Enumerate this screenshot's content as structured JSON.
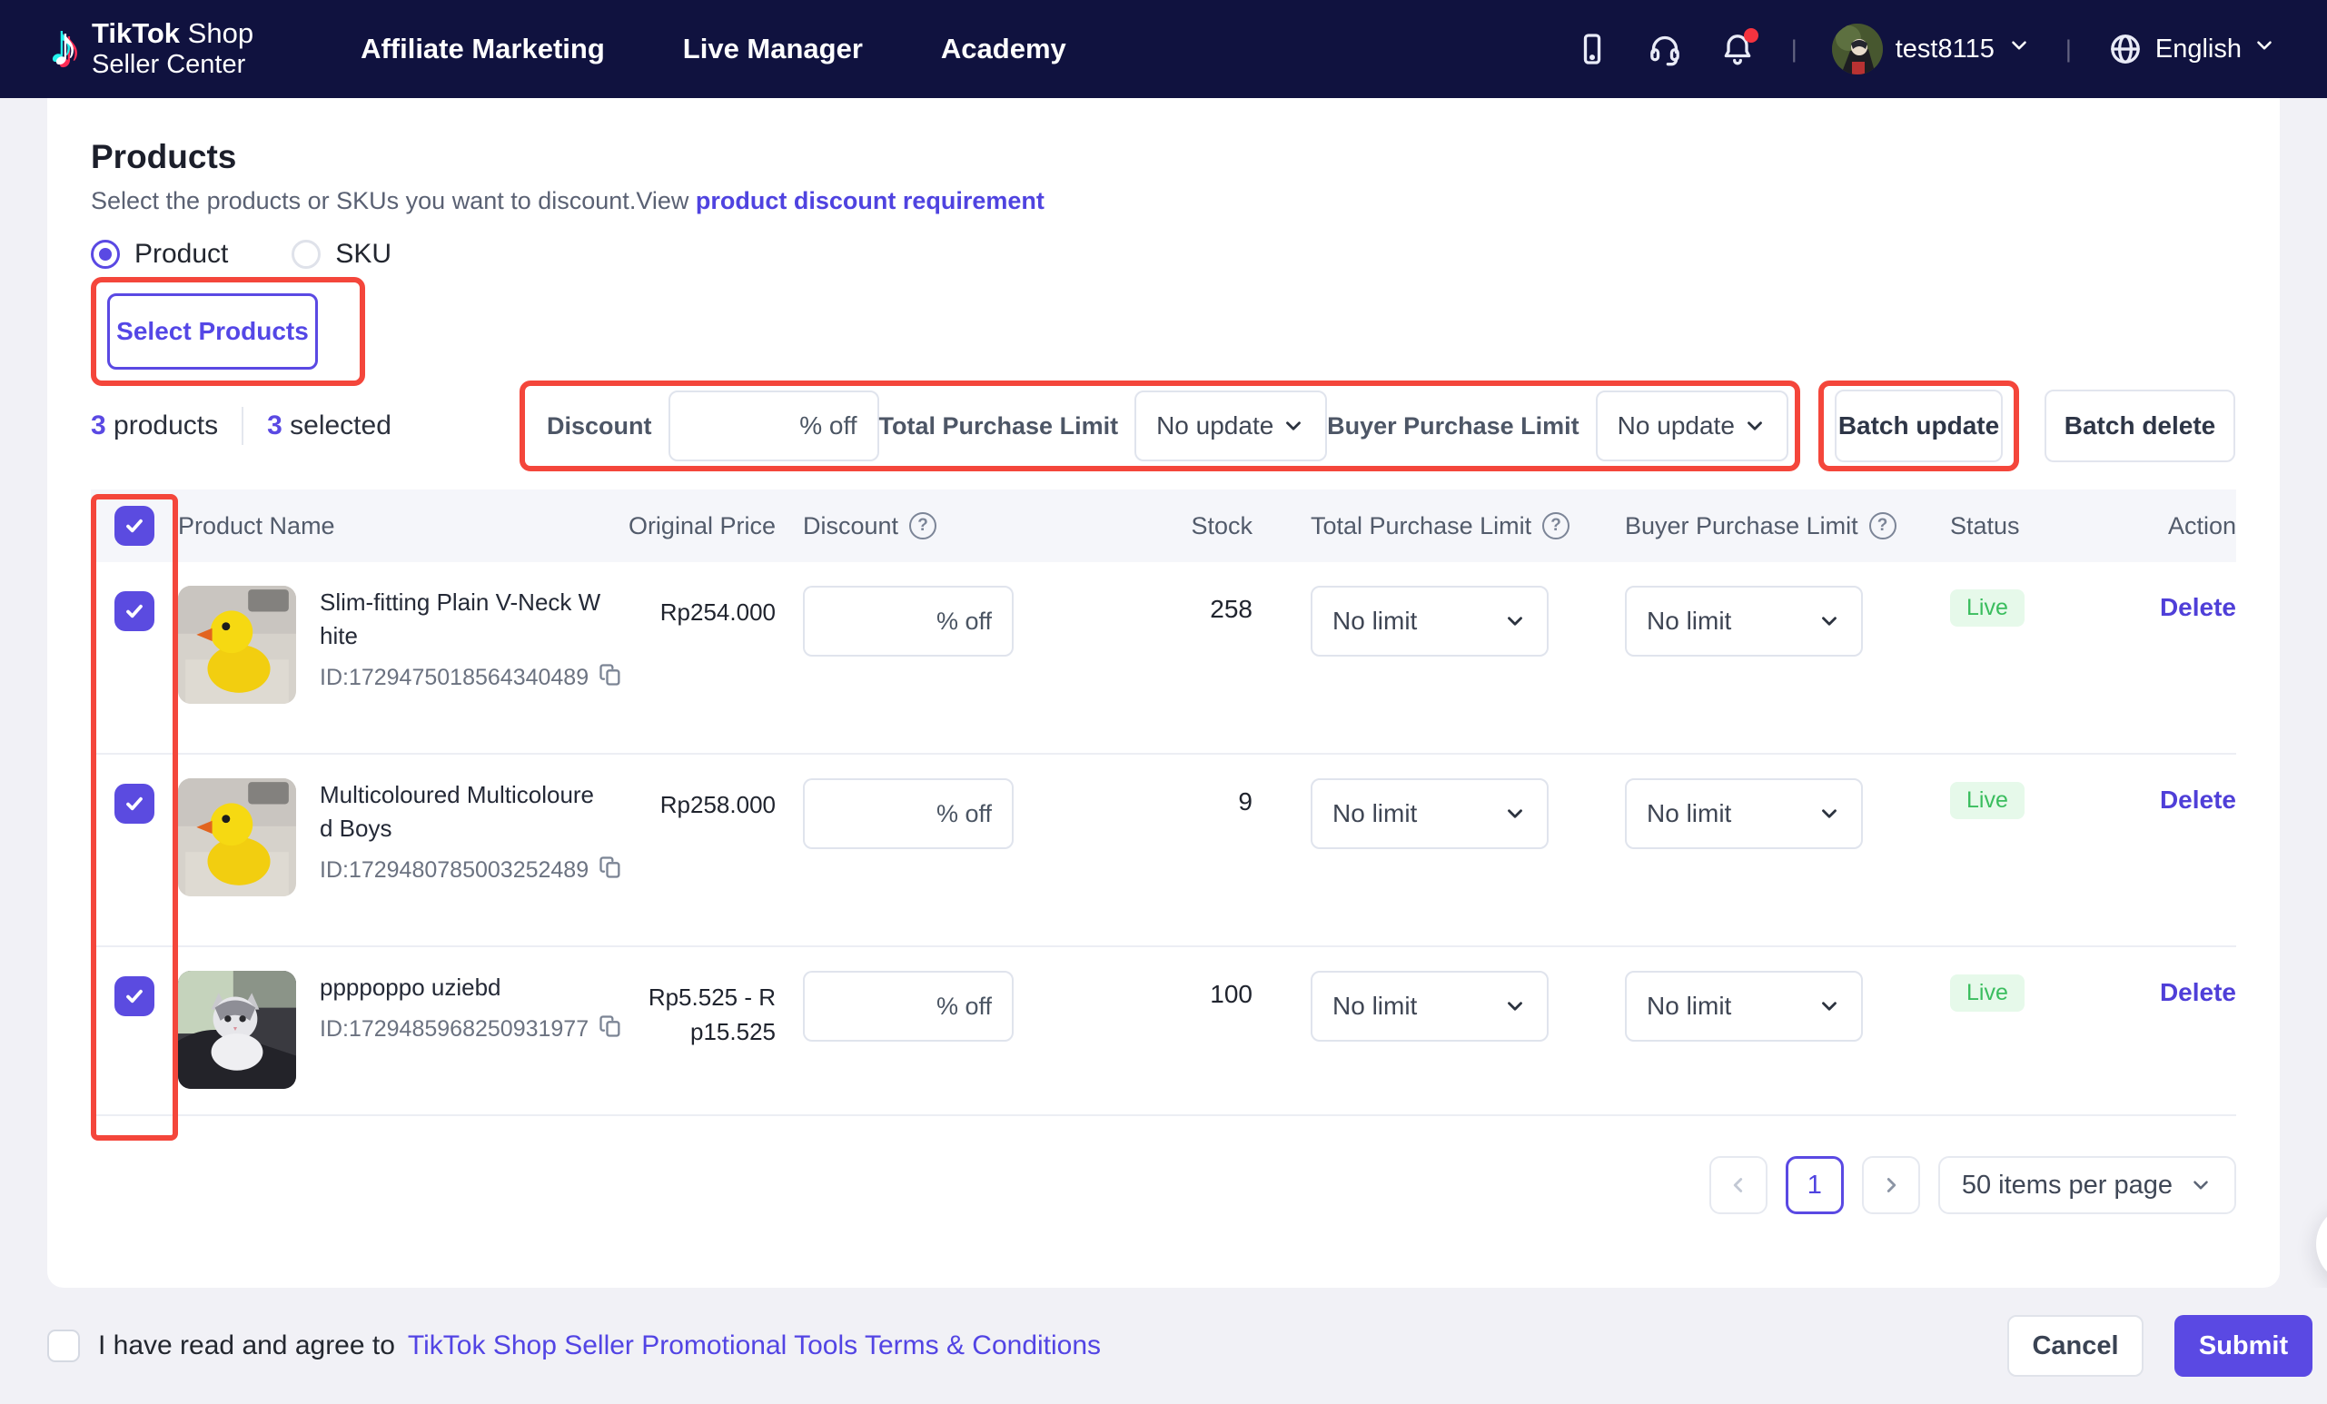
{
  "nav": {
    "logo": {
      "note_glyph": "♪",
      "title_bold": "TikTok",
      "title_rest": " Shop",
      "subtitle": "Seller Center"
    },
    "items": [
      {
        "label": "Affiliate Marketing"
      },
      {
        "label": "Live Manager"
      },
      {
        "label": "Academy"
      }
    ],
    "username": "test8115",
    "language": "English",
    "divider": "|",
    "icons": {
      "mobile": "mobile-app-icon",
      "support": "headset-icon",
      "notifications": "bell-icon",
      "language": "globe-icon"
    }
  },
  "products_section": {
    "title": "Products",
    "subtitle": "Select the products or SKUs you want to discount.View",
    "subtitle_link": "product discount requirement",
    "radio_product": "Product",
    "radio_sku": "SKU",
    "select_products_button": "Select Products",
    "products_count": "3",
    "products_count_label": "products",
    "selected_count": "3",
    "selected_count_label": "selected"
  },
  "batch_bar": {
    "discount_label": "Discount",
    "discount_value": "",
    "discount_suffix": "% off",
    "total_limit_label": "Total Purchase Limit",
    "total_limit_value": "No update",
    "buyer_limit_label": "Buyer Purchase Limit",
    "buyer_limit_value": "No update",
    "batch_update": "Batch update",
    "batch_delete": "Batch delete"
  },
  "table": {
    "help_glyph": "?",
    "headers": {
      "product_name": "Product Name",
      "original_price": "Original Price",
      "discount": "Discount",
      "stock": "Stock",
      "total_purchase_limit": "Total Purchase Limit",
      "buyer_purchase_limit": "Buyer Purchase Limit",
      "status": "Status",
      "action": "Action"
    },
    "rows": [
      {
        "name": "Slim-fitting Plain V-Neck White",
        "id": "ID:1729475018564340489",
        "price": "Rp254.000",
        "discount_suffix": "% off",
        "stock": "258",
        "total_limit": "No limit",
        "buyer_limit": "No limit",
        "status": "Live",
        "action": "Delete",
        "image": "rubber-duck-photo"
      },
      {
        "name": "Multicoloured Multicoloured Boys",
        "id": "ID:1729480785003252489",
        "price": "Rp258.000",
        "discount_suffix": "% off",
        "stock": "9",
        "total_limit": "No limit",
        "buyer_limit": "No limit",
        "status": "Live",
        "action": "Delete",
        "image": "rubber-duck-photo"
      },
      {
        "name": "ppppoppo uziebd",
        "id": "ID:1729485968250931977",
        "price": "Rp5.525 - Rp15.525",
        "discount_suffix": "% off",
        "stock": "100",
        "total_limit": "No limit",
        "buyer_limit": "No limit",
        "status": "Live",
        "action": "Delete",
        "image": "cat-photo"
      }
    ]
  },
  "pagination": {
    "page": "1",
    "page_size": "50 items per page"
  },
  "footer": {
    "agreement": "I have read and agree to",
    "terms_link": "TikTok Shop Seller Promotional Tools Terms & Conditions",
    "cancel": "Cancel",
    "submit": "Submit"
  },
  "colors": {
    "navbar": "#10123f",
    "accent_purple": "#5a49e3",
    "link_purple": "#4f43e0",
    "annotation_red": "#f4463b",
    "live_text": "#3abd5e",
    "live_bg": "#e6f9ea",
    "page_bg": "#f1f1f6",
    "header_row_bg": "#f5f6fa"
  }
}
